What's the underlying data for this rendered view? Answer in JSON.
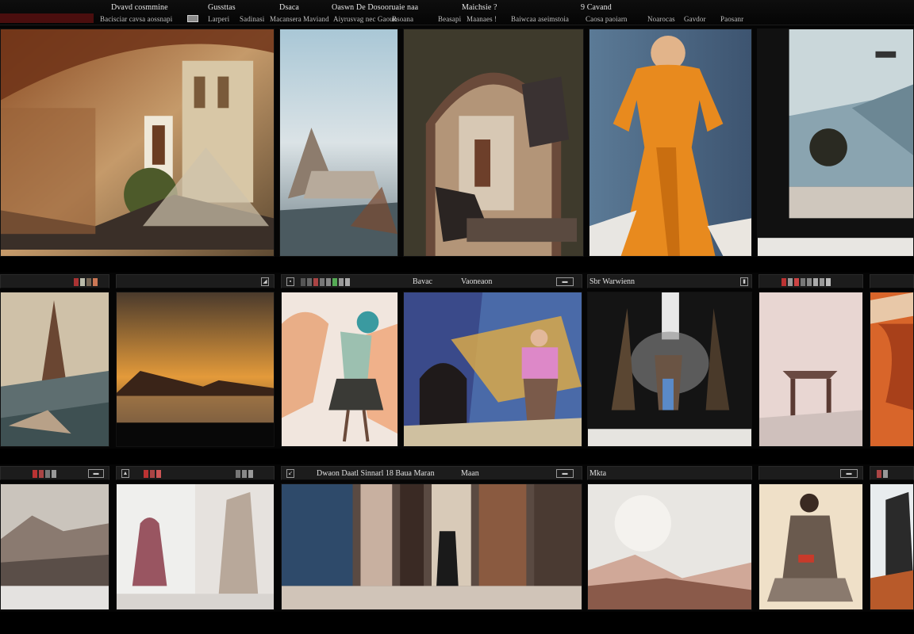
{
  "menubar": {
    "row1": [
      "Dvavd cosmmine",
      "Gussttas",
      "Dsaca",
      "Oaswn De Dosooruaie naa",
      "Maichsie ?",
      "9 Cavand"
    ],
    "row2": [
      "Bacisciar cavsa aossnapi",
      "Larperi",
      "Sadinasi",
      "Macansera",
      "Maviand",
      "Aiyrusvag nec Gaoun",
      "Rsoana",
      "Beasapi",
      "Maanaes !",
      "Baiwcaa aseimstoia",
      "Caosa paoiarn",
      "Noarocas",
      "Gavdor",
      "Paosanr"
    ]
  },
  "panels": {
    "row2": {
      "mid_title": "Bavac",
      "mid_subtitle": "Vaoneaon",
      "right_title": "Sbr  Warwienn"
    },
    "row3": {
      "mid_title": "Dwaon  Daatl Sinnarl 18  Baua Maran",
      "mid_extra": "Maan",
      "right_title": "Mkta"
    }
  },
  "colors": {
    "accent_red": "#4a0e0e",
    "header_bg": "#1c1c1c",
    "background": "#050505"
  },
  "icons": [
    "gallery-tile-icon",
    "menu-icon",
    "panel-options-icon"
  ]
}
